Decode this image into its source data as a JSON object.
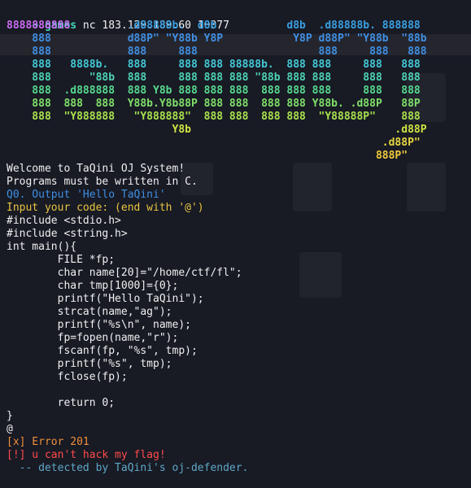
{
  "prompt": {
    "arrow": "➜",
    "directory": "games",
    "command": " nc 183.129.189.60 10077"
  },
  "ascii_banner": [
    [
      {
        "t": "8888888888",
        "c": "#c86cf0"
      },
      {
        "t": "         .d88888b.  d8b           d8b  .d88888b. 888888",
        "c": "#3a9fe0"
      }
    ],
    [
      {
        "t": "    888            d88P\" \"Y88b Y8P           Y8P d88P\" \"Y88b  \"88b",
        "c": "#3f8fe3"
      }
    ],
    [
      {
        "t": "    888            888     888                   888     888   888",
        "c": "#3f8fe3"
      }
    ],
    [
      {
        "t": "    888   8888b.   888     888 888 88888b.  888 888     888   888",
        "c": "#43c9d6"
      }
    ],
    [
      {
        "t": "    888      \"88b  888     888 888 888 \"88b 888 888     888   888",
        "c": "#4ed3b4"
      }
    ],
    [
      {
        "t": "    888  .d888888  888 Y8b 888 888 888  888 888 888     888   888",
        "c": "#57d98f"
      }
    ],
    [
      {
        "t": "    888  888  888  Y88b.Y8b88P 888 888  888 888 Y88b. .d88P   88P",
        "c": "#7fe06a"
      }
    ],
    [
      {
        "t": "    888  \"Y888888   \"Y888888\"  888 888  888 888  \"Y88888P\"    888",
        "c": "#a8e04d"
      }
    ],
    [
      {
        "t": "                          Y8b                                .d88P",
        "c": "#cfe244"
      }
    ],
    [
      {
        "t": "                                                           .d88P\"",
        "c": "#e5d741"
      }
    ],
    [
      {
        "t": "                                                          888P\"",
        "c": "#f0c93a"
      }
    ]
  ],
  "output": [
    {
      "text": "Welcome to TaQini OJ System!",
      "style": "white"
    },
    {
      "text": "Programs must be written in C.",
      "style": "white"
    },
    {
      "text": "Q0. Output 'Hello TaQini'",
      "style": "blue"
    },
    {
      "text": "Input your code: (end with '@')",
      "style": "yellow"
    },
    {
      "text": "#include <stdio.h>",
      "style": "white"
    },
    {
      "text": "#include <string.h>",
      "style": "white"
    },
    {
      "text": "int main(){",
      "style": "white"
    },
    {
      "text": "        FILE *fp;",
      "style": "white"
    },
    {
      "text": "        char name[20]=\"/home/ctf/fl\";",
      "style": "white"
    },
    {
      "text": "        char tmp[1000]={0};",
      "style": "white"
    },
    {
      "text": "        printf(\"Hello TaQini\");",
      "style": "white"
    },
    {
      "text": "        strcat(name,\"ag\");",
      "style": "white"
    },
    {
      "text": "        printf(\"%s\\n\", name);",
      "style": "white"
    },
    {
      "text": "        fp=fopen(name,\"r\");",
      "style": "white"
    },
    {
      "text": "        fscanf(fp, \"%s\", tmp);",
      "style": "white"
    },
    {
      "text": "        printf(\"%s\", tmp);",
      "style": "white"
    },
    {
      "text": "        fclose(fp);",
      "style": "white"
    },
    {
      "text": "",
      "style": "white"
    },
    {
      "text": "        return 0;",
      "style": "white"
    },
    {
      "text": "}",
      "style": "white"
    },
    {
      "text": "@",
      "style": "white"
    },
    {
      "text": "[x] Error 201",
      "style": "orange"
    },
    {
      "text": "[!] u can't hack my flag!",
      "style": "red"
    },
    {
      "text": "  -- detected by TaQini's oj-defender.",
      "style": "muted"
    }
  ],
  "colors": {
    "background": "#181a24",
    "prompt": "#43d9bd",
    "white": "#f0f0f0",
    "blue": "#3f8fe3",
    "yellow": "#e8c541",
    "orange": "#ef8f3c",
    "red": "#ff4b4b",
    "muted": "#5fa8c7"
  }
}
